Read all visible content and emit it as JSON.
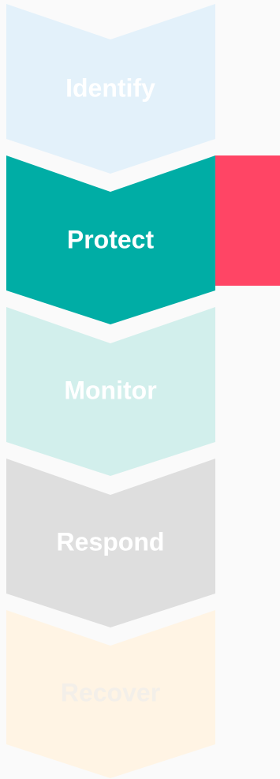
{
  "steps": [
    {
      "label": "Identify",
      "fill": "#e3f1fa",
      "text_color": "#ffffff",
      "active": false
    },
    {
      "label": "Protect",
      "fill": "#00ada5",
      "text_color": "#ffffff",
      "active": true
    },
    {
      "label": "Monitor",
      "fill": "#d2efec",
      "text_color": "#ffffff",
      "active": false
    },
    {
      "label": "Respond",
      "fill": "#dedede",
      "text_color": "#ffffff",
      "active": false
    },
    {
      "label": "Recover",
      "fill": "#fff4e4",
      "text_color": "#f3efe9",
      "active": false
    }
  ],
  "active_marker": {
    "color": "#ff4565"
  }
}
